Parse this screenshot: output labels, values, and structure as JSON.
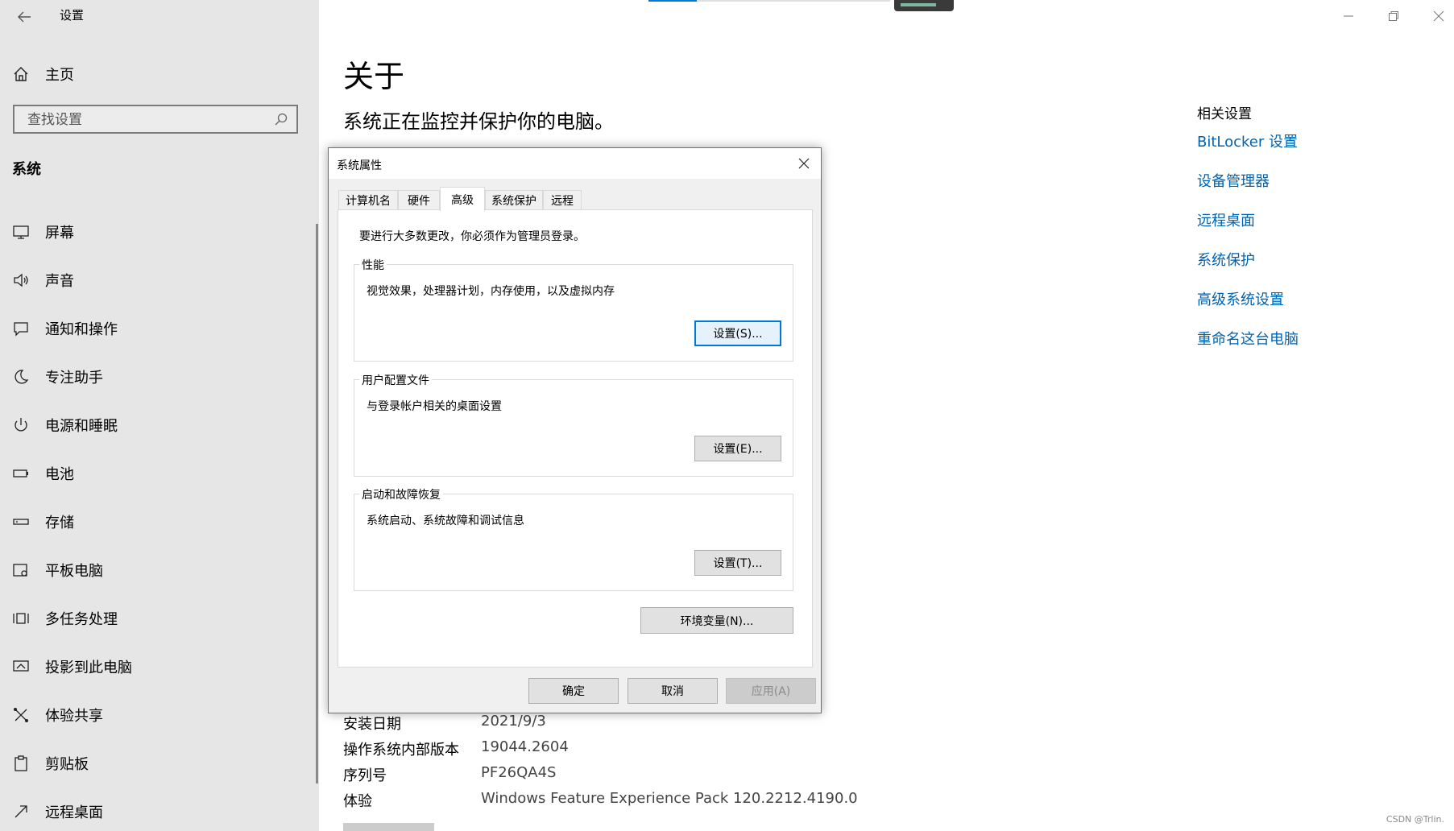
{
  "window": {
    "title": "设置"
  },
  "sidebar": {
    "home_label": "主页",
    "search_placeholder": "查找设置",
    "section_title": "系统",
    "items": [
      {
        "label": "屏幕",
        "icon": "monitor-icon"
      },
      {
        "label": "声音",
        "icon": "speaker-icon"
      },
      {
        "label": "通知和操作",
        "icon": "notification-icon"
      },
      {
        "label": "专注助手",
        "icon": "moon-icon"
      },
      {
        "label": "电源和睡眠",
        "icon": "power-icon"
      },
      {
        "label": "电池",
        "icon": "battery-icon"
      },
      {
        "label": "存储",
        "icon": "storage-icon"
      },
      {
        "label": "平板电脑",
        "icon": "tablet-icon"
      },
      {
        "label": "多任务处理",
        "icon": "multitask-icon"
      },
      {
        "label": "投影到此电脑",
        "icon": "project-icon"
      },
      {
        "label": "体验共享",
        "icon": "share-icon"
      },
      {
        "label": "剪贴板",
        "icon": "clipboard-icon"
      },
      {
        "label": "远程桌面",
        "icon": "remote-desktop-icon"
      }
    ]
  },
  "main": {
    "title": "关于",
    "subtitle": "系统正在监控并保护你的电脑。",
    "related": {
      "heading": "相关设置",
      "links": [
        "BitLocker 设置",
        "设备管理器",
        "远程桌面",
        "系统保护",
        "高级系统设置",
        "重命名这台电脑"
      ]
    },
    "specs": [
      {
        "key": "安装日期",
        "value": "2021/9/3"
      },
      {
        "key": "操作系统内部版本",
        "value": "19044.2604"
      },
      {
        "key": "序列号",
        "value": "PF26QA4S"
      },
      {
        "key": "体验",
        "value": "Windows Feature Experience Pack 120.2212.4190.0"
      }
    ]
  },
  "dialog": {
    "title": "系统属性",
    "tabs": [
      "计算机名",
      "硬件",
      "高级",
      "系统保护",
      "远程"
    ],
    "active_tab": "高级",
    "note": "要进行大多数更改，你必须作为管理员登录。",
    "performance": {
      "legend": "性能",
      "desc": "视觉效果，处理器计划，内存使用，以及虚拟内存",
      "button": "设置(S)..."
    },
    "profiles": {
      "legend": "用户配置文件",
      "desc": "与登录帐户相关的桌面设置",
      "button": "设置(E)..."
    },
    "startup": {
      "legend": "启动和故障恢复",
      "desc": "系统启动、系统故障和调试信息",
      "button": "设置(T)..."
    },
    "env_button": "环境变量(N)...",
    "ok": "确定",
    "cancel": "取消",
    "apply": "应用(A)"
  },
  "watermark": "CSDN @Trlin.",
  "colors": {
    "sidebar_bg": "#e6e6e6",
    "link": "#0063b1",
    "accent": "#0078d7",
    "dialog_bg": "#f0f0f0"
  }
}
